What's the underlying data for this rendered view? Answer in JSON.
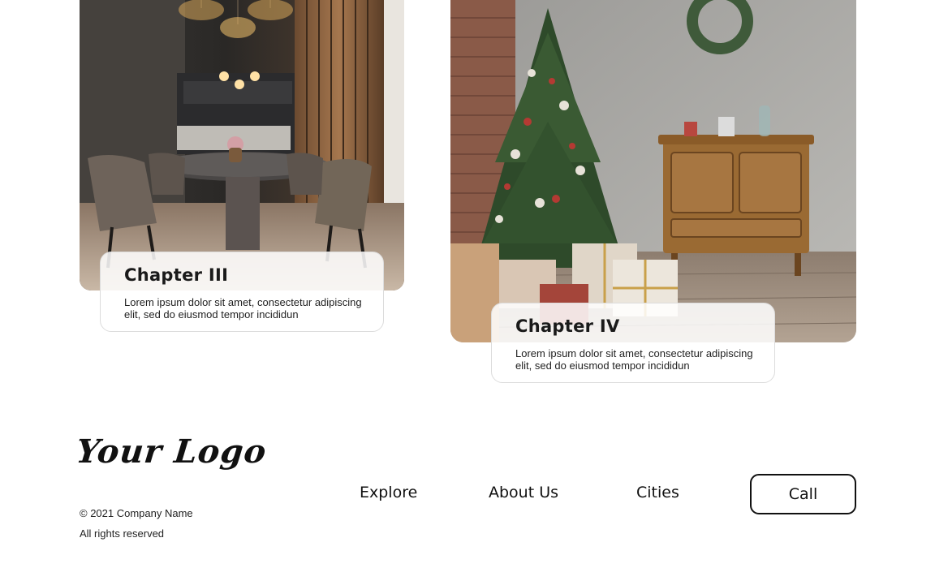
{
  "cards": [
    {
      "title": "Chapter III",
      "description": "Lorem ipsum dolor sit amet, consectetur adipiscing elit, sed do eiusmod tempor incididun",
      "image": "dining-room-photo"
    },
    {
      "title": "Chapter IV",
      "description": "Lorem ipsum dolor sit amet, consectetur adipiscing elit, sed do eiusmod tempor incididun",
      "image": "christmas-tree-photo"
    }
  ],
  "footer": {
    "logo": "Your Logo",
    "copyright_line1": "©  2021  Company Name",
    "copyright_line2": "All rights reserved",
    "nav": {
      "explore": "Explore",
      "about": "About Us",
      "cities": "Cities"
    },
    "call_button": "Call"
  },
  "colors": {
    "text": "#111111",
    "card_border": "#dcdcdc",
    "background": "#ffffff"
  }
}
